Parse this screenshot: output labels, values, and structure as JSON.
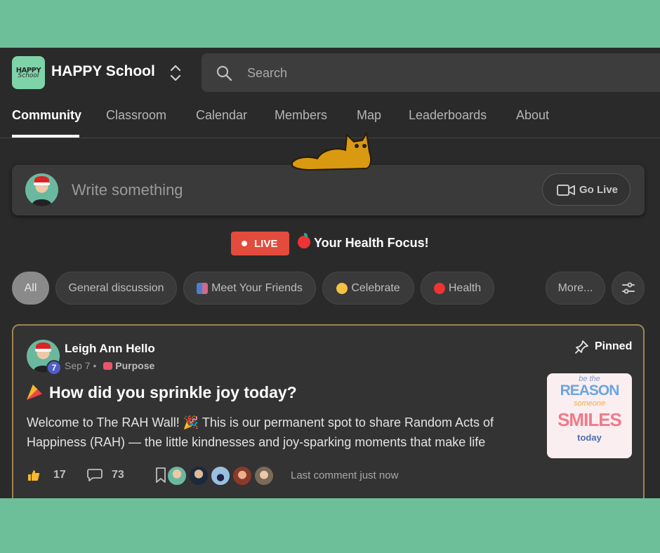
{
  "header": {
    "logo_text_top": "HAPPY",
    "logo_text_bottom": "School",
    "school_name": "HAPPY School",
    "search_placeholder": "Search"
  },
  "tabs": [
    {
      "label": "Community",
      "active": true
    },
    {
      "label": "Classroom"
    },
    {
      "label": "Calendar"
    },
    {
      "label": "Members"
    },
    {
      "label": "Map"
    },
    {
      "label": "Leaderboards"
    },
    {
      "label": "About"
    }
  ],
  "composer": {
    "placeholder": "Write something",
    "go_live_label": "Go Live"
  },
  "live_banner": {
    "badge": "LIVE",
    "title": "Your Health Focus!"
  },
  "filters": [
    {
      "label": "All",
      "selected": true
    },
    {
      "label": "General discussion"
    },
    {
      "label": "Meet Your Friends",
      "icon": "people-icon"
    },
    {
      "label": "Celebrate",
      "icon": "party-face-icon"
    },
    {
      "label": "Health",
      "icon": "apple-icon"
    },
    {
      "label": "More..."
    }
  ],
  "post": {
    "author": "Leigh Ann Hello",
    "level": "7",
    "date": "Sep 7",
    "separator": "•",
    "category": "Purpose",
    "pinned_label": "Pinned",
    "title": "How did you sprinkle joy today?",
    "body": "Welcome to The RAH Wall! 🎉 This is our permanent spot to share Random Acts of Happiness (RAH) — the little kindnesses and joy-sparking moments that make life",
    "likes": "17",
    "comments": "73",
    "last_comment": "Last comment just now",
    "thumbnail": {
      "line1": "be the",
      "line2": "REASON",
      "line3": "someone",
      "line4": "SMILES",
      "line5": "today"
    }
  },
  "colors": {
    "page_background": "#6dbf9a",
    "app_background": "#2a2a2a",
    "live_red": "#e34b3c",
    "pinned_border": "#9a8656",
    "level_badge": "#4f5ec9"
  }
}
